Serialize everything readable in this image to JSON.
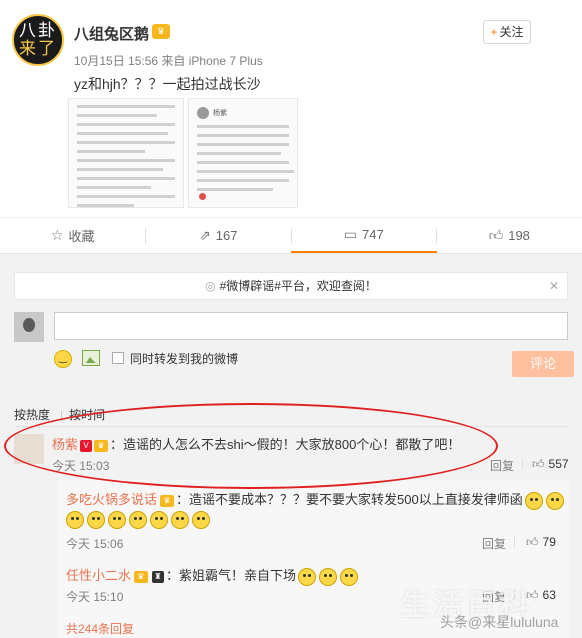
{
  "post": {
    "avatar_text_line1": "八卦",
    "avatar_text_line2": "来了",
    "author": "八组兔区鹅",
    "vip_icon": "vip-crown-icon",
    "meta": "10月15日 15:56 来自 iPhone 7 Plus",
    "follow_label": "关注",
    "text": "yz和hjh？？？一起拍过战长沙"
  },
  "actions": {
    "favorite_label": "收藏",
    "repost_count": "167",
    "comment_count": "747",
    "like_count": "198"
  },
  "notice": {
    "text": "#微博辟谣#平台，欢迎查阅！"
  },
  "composer": {
    "input_placeholder": "",
    "repost_label": "同时转发到我的微博",
    "submit_label": "评论"
  },
  "sort": {
    "hot_label": "按热度",
    "time_label": "按时间"
  },
  "comments": [
    {
      "user": "杨紫",
      "text": "：造谣的人怎么不去shi～假的！大家放800个心！都散了吧！",
      "time": "今天 15:03",
      "reply_label": "回复",
      "likes": "557"
    }
  ],
  "subcomments": [
    {
      "user": "多吃火锅多说话",
      "text": "：造谣不要成本？？？要不要大家转发500以上直接发律师函",
      "time": "今天 15:06",
      "reply_label": "回复",
      "likes": "79"
    },
    {
      "user": "任性小二水",
      "text": "：紫姐霸气！亲自下场",
      "time": "今天 15:10",
      "reply_label": "回复",
      "likes": "63"
    }
  ],
  "more_label": "共244条回复",
  "watermark": {
    "line1": "生活百科",
    "line2": "头条@来星lululuna"
  },
  "colors": {
    "accent": "#ff8200",
    "username": "#eb7350",
    "highlight_circle": "#e02020"
  }
}
